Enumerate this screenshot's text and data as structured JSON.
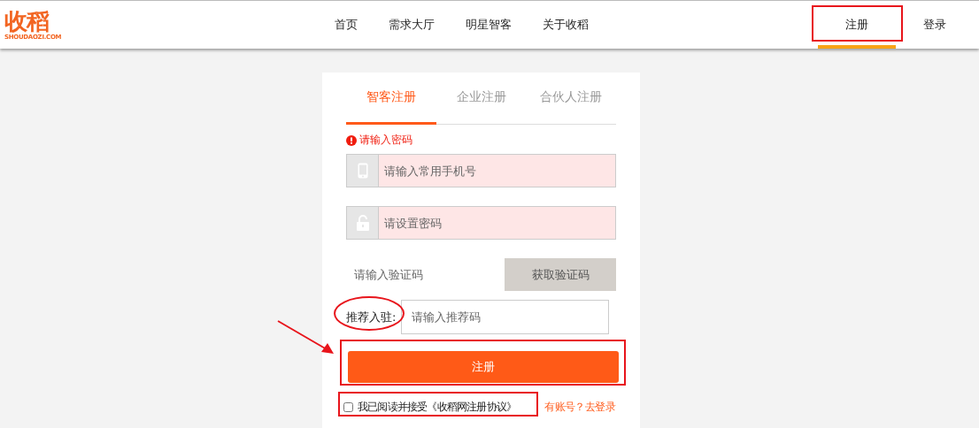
{
  "logo": {
    "name": "收稻",
    "domain": "SHOUDAOZI.COM"
  },
  "nav": [
    {
      "label": "首页"
    },
    {
      "label": "需求大厅"
    },
    {
      "label": "明星智客"
    },
    {
      "label": "关于收稻"
    }
  ],
  "account_nav": [
    {
      "label": "注册",
      "selected": true
    },
    {
      "label": "登录",
      "selected": false
    }
  ],
  "tabs": [
    {
      "label": "智客注册",
      "selected": true
    },
    {
      "label": "企业注册",
      "selected": false
    },
    {
      "label": "合伙人注册",
      "selected": false
    }
  ],
  "error": "请输入密码",
  "fields": [
    {
      "kind": "phone",
      "placeholder": "请输入常用手机号",
      "invalid": true
    },
    {
      "kind": "password",
      "placeholder": "请设置密码",
      "invalid": true
    }
  ],
  "code": {
    "placeholder": "请输入验证码",
    "button": "获取验证码"
  },
  "referral": {
    "label": "推荐入驻:",
    "placeholder": "请输入推荐码"
  },
  "submit": "注册",
  "agreement": {
    "checked": false,
    "text": "我已阅读并接受《收稻网注册协议》",
    "login_prompt": "有账号？去登录"
  }
}
